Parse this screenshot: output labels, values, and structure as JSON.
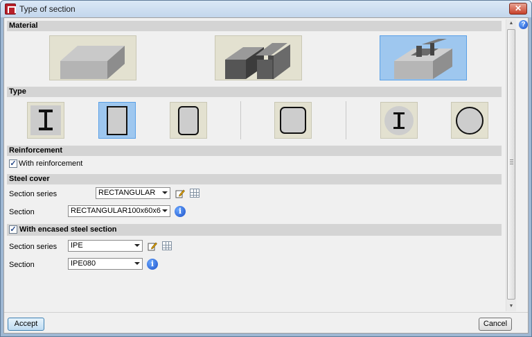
{
  "window": {
    "title": "Type of section",
    "close_symbol": "✕"
  },
  "sections": {
    "material": "Material",
    "type": "Type",
    "reinforcement": "Reinforcement",
    "steel_cover": "Steel cover",
    "encased": "With encased steel section"
  },
  "material_tiles": [
    {
      "name": "concrete",
      "selected": false
    },
    {
      "name": "steel",
      "selected": false
    },
    {
      "name": "composite",
      "selected": true
    }
  ],
  "type_tiles": [
    {
      "name": "i-shape",
      "selected": false
    },
    {
      "name": "rectangular",
      "selected": true
    },
    {
      "name": "rounded-rectangular",
      "selected": false
    },
    {
      "name": "rounded-square",
      "selected": false
    },
    {
      "name": "circle-with-i",
      "selected": false
    },
    {
      "name": "circular",
      "selected": false
    }
  ],
  "reinforcement": {
    "checkbox_label": "With reinforcement",
    "checked": true
  },
  "steel_cover": {
    "series_label": "Section series",
    "series_value": "RECTANGULAR",
    "section_label": "Section",
    "section_value": "RECTANGULAR100x60x6"
  },
  "encased": {
    "checked": true,
    "series_label": "Section series",
    "series_value": "IPE",
    "section_label": "Section",
    "section_value": "IPE080"
  },
  "buttons": {
    "accept": "Accept",
    "cancel": "Cancel"
  },
  "glyphs": {
    "check": "✓",
    "info": "i",
    "help": "?",
    "up": "▲",
    "down": "▼"
  }
}
